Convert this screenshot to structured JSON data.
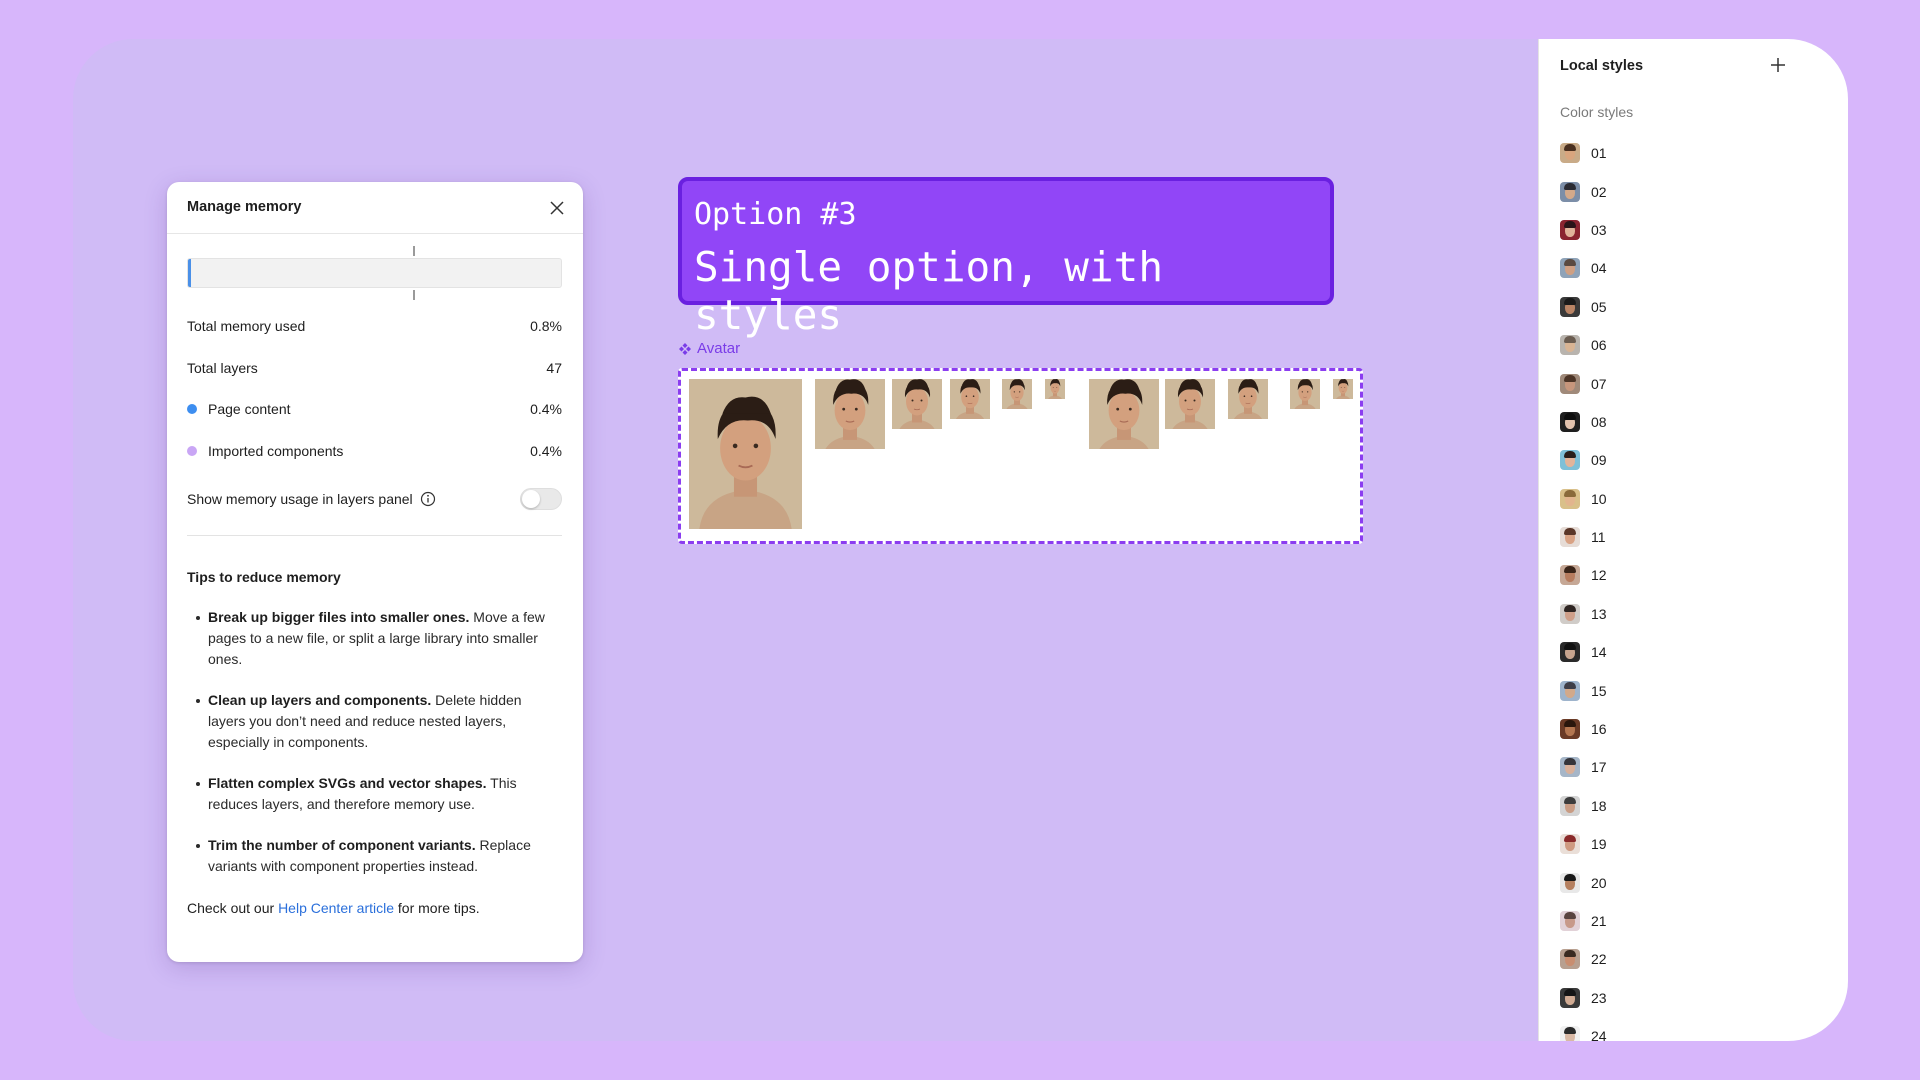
{
  "dialog": {
    "title": "Manage memory",
    "memory_fraction": 0.008,
    "total_memory_label": "Total memory used",
    "total_memory_value": "0.8%",
    "total_layers_label": "Total layers",
    "total_layers_value": "47",
    "page_content_label": "Page content",
    "page_content_value": "0.4%",
    "imported_label": "Imported components",
    "imported_value": "0.4%",
    "toggle_label": "Show memory usage in layers panel",
    "toggle_on": false,
    "tips_title": "Tips to reduce memory",
    "tips": [
      {
        "bold": "Break up bigger files into smaller ones.",
        "text": " Move a few pages to a new file, or split a large library into smaller ones."
      },
      {
        "bold": "Clean up layers and components.",
        "text": " Delete hidden layers you don’t need and reduce nested layers, especially in components."
      },
      {
        "bold": "Flatten complex SVGs and vector shapes.",
        "text": " This reduces layers, and therefore memory use."
      },
      {
        "bold": "Trim the number of component variants.",
        "text": " Replace variants with component properties instead."
      }
    ],
    "footer_prefix": "Check out our ",
    "footer_link": "Help Center article",
    "footer_suffix": " for more tips.",
    "colors": {
      "page_content": "#3d8ef0",
      "imported": "#c9a6f5",
      "bar_fill": "#4a90e8"
    }
  },
  "banner": {
    "line1": "Option #3",
    "line2": "Single option, with styles"
  },
  "component": {
    "label": "Avatar"
  },
  "panel": {
    "title": "Local styles",
    "subtitle": "Color styles",
    "styles": [
      {
        "label": "01",
        "bg": "#c9ab88",
        "face": "#d9a57e",
        "hair": "#4a3020"
      },
      {
        "label": "02",
        "bg": "#7c8ea8",
        "face": "#d4a98a",
        "hair": "#2b2b33"
      },
      {
        "label": "03",
        "bg": "#8a2430",
        "face": "#e0b39a",
        "hair": "#2a1418"
      },
      {
        "label": "04",
        "bg": "#8fa3b8",
        "face": "#cfa083",
        "hair": "#5a4a40"
      },
      {
        "label": "05",
        "bg": "#3a3a3a",
        "face": "#b98465",
        "hair": "#1a1a1a"
      },
      {
        "label": "06",
        "bg": "#b9b4ae",
        "face": "#d8b494",
        "hair": "#6a5c50"
      },
      {
        "label": "07",
        "bg": "#a08a7a",
        "face": "#c7967c",
        "hair": "#4c3426"
      },
      {
        "label": "08",
        "bg": "#1f1f1f",
        "face": "#e2c2ad",
        "hair": "#0d0d0d"
      },
      {
        "label": "09",
        "bg": "#7fc0d8",
        "face": "#e3b49a",
        "hair": "#2a1e1a"
      },
      {
        "label": "10",
        "bg": "#d9c08a",
        "face": "#e2b58e",
        "hair": "#8a6a3a"
      },
      {
        "label": "11",
        "bg": "#e6dcd6",
        "face": "#d9a284",
        "hair": "#5a3628"
      },
      {
        "label": "12",
        "bg": "#c6a896",
        "face": "#b77c5e",
        "hair": "#3a2418"
      },
      {
        "label": "13",
        "bg": "#d0ccc8",
        "face": "#cfa08a",
        "hair": "#2e2522"
      },
      {
        "label": "14",
        "bg": "#2a2a2a",
        "face": "#c7a48e",
        "hair": "#111111"
      },
      {
        "label": "15",
        "bg": "#9eb4cc",
        "face": "#d2a98a",
        "hair": "#3e3e48"
      },
      {
        "label": "16",
        "bg": "#6a3a26",
        "face": "#b47650",
        "hair": "#2a160c"
      },
      {
        "label": "17",
        "bg": "#a6b6c8",
        "face": "#d8b09a",
        "hair": "#34343a"
      },
      {
        "label": "18",
        "bg": "#d4d4d4",
        "face": "#c99c84",
        "hair": "#3c3c3c"
      },
      {
        "label": "19",
        "bg": "#eadfd8",
        "face": "#cf9a80",
        "hair": "#8a2a2a"
      },
      {
        "label": "20",
        "bg": "#e8e8e8",
        "face": "#b58060",
        "hair": "#1a1a1a"
      },
      {
        "label": "21",
        "bg": "#e2d2d8",
        "face": "#c79a8a",
        "hair": "#5a4440"
      },
      {
        "label": "22",
        "bg": "#b8a090",
        "face": "#c98e70",
        "hair": "#3a2a20"
      },
      {
        "label": "23",
        "bg": "#3a3a3a",
        "face": "#d2ac94",
        "hair": "#151515"
      },
      {
        "label": "24",
        "bg": "#f0f0f0",
        "face": "#d8b8a4",
        "hair": "#2a2a2a"
      }
    ]
  }
}
